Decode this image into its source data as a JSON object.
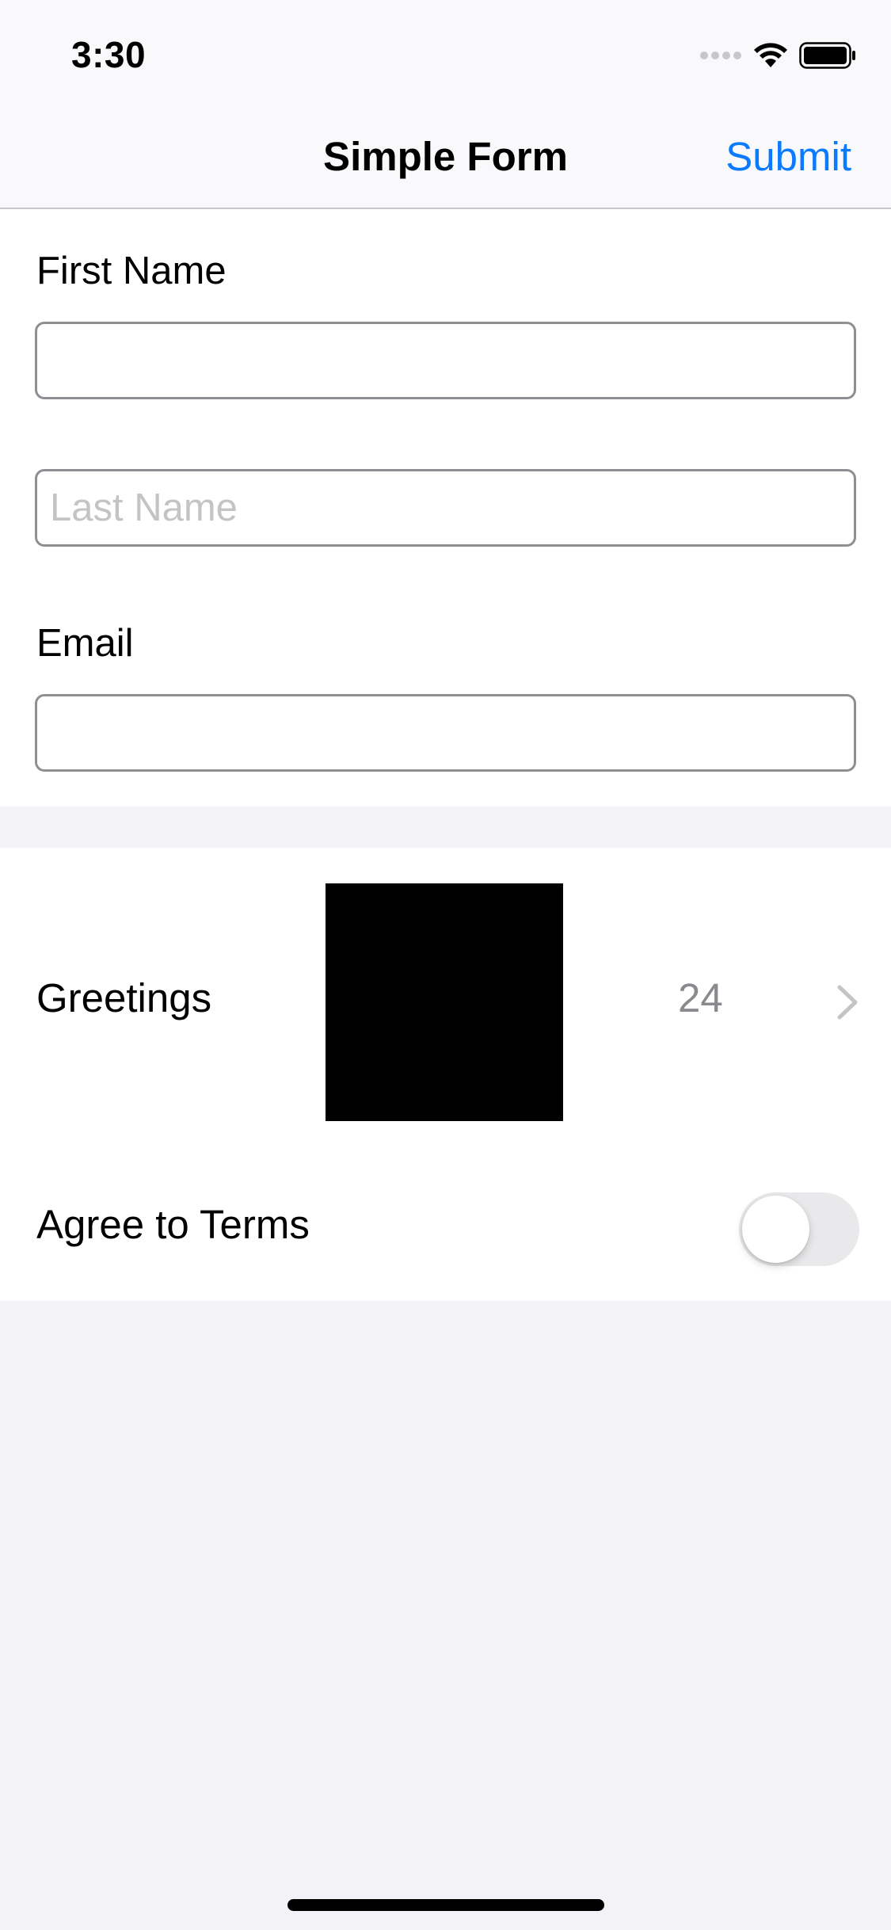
{
  "status_bar": {
    "time": "3:30",
    "icons": [
      "signal-icon",
      "wifi-icon",
      "battery-icon"
    ]
  },
  "nav": {
    "title": "Simple Form",
    "submit_label": "Submit",
    "accent_color": "#0a7aff"
  },
  "form": {
    "first_name": {
      "label": "First Name",
      "value": "",
      "placeholder": ""
    },
    "last_name": {
      "value": "",
      "placeholder": "Last Name"
    },
    "email": {
      "label": "Email",
      "value": "",
      "placeholder": ""
    }
  },
  "greetings": {
    "label": "Greetings",
    "value": "24"
  },
  "terms": {
    "label": "Agree to Terms",
    "toggle_on": false
  }
}
